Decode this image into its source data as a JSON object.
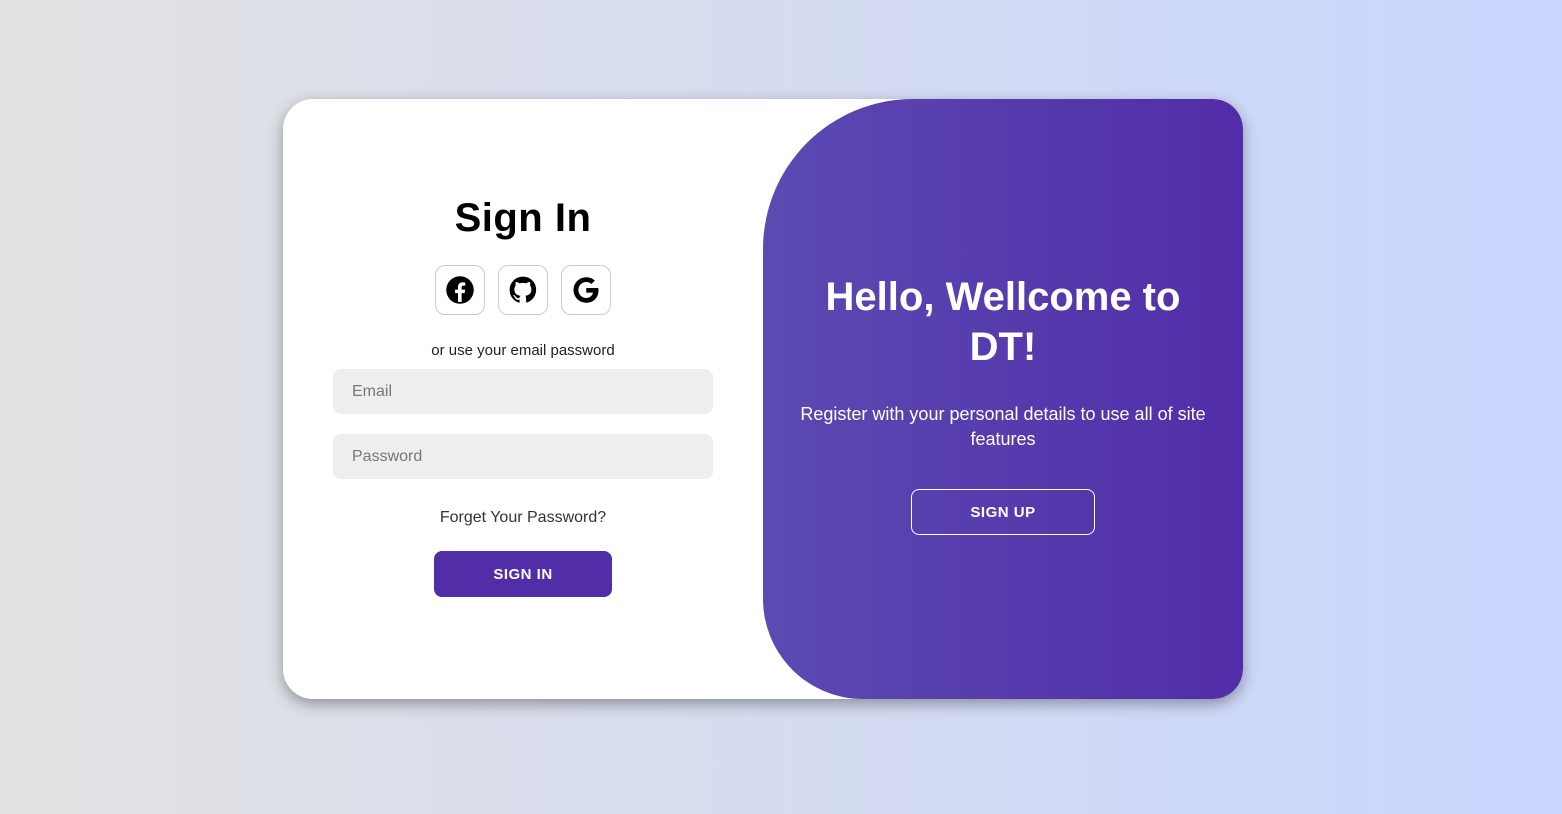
{
  "signin": {
    "title": "Sign In",
    "social_icons": [
      "facebook-icon",
      "github-icon",
      "google-icon"
    ],
    "alt_text": "or use your email password",
    "email_placeholder": "Email",
    "email_value": "",
    "password_placeholder": "Password",
    "password_value": "",
    "forgot_label": "Forget Your Password?",
    "button_label": "SIGN IN"
  },
  "panel": {
    "title": "Hello, Wellcome to DT!",
    "subtitle": "Register with your personal details to use all of site features",
    "button_label": "SIGN UP"
  },
  "colors": {
    "accent": "#512da8",
    "panel_gradient_start": "#5c4ab2",
    "background_start": "#e2e2e2",
    "background_end": "#c9d6ff"
  }
}
